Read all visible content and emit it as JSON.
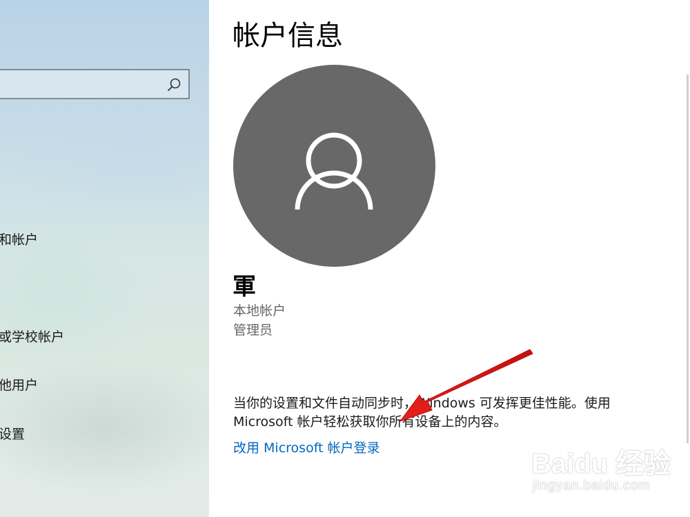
{
  "sidebar": {
    "search_placeholder": "",
    "items": [
      {
        "label": "和帐户"
      },
      {
        "label": "或学校帐户"
      },
      {
        "label": "他用户"
      },
      {
        "label": "设置"
      }
    ]
  },
  "main": {
    "title": "帐户信息",
    "user": {
      "name": "軍",
      "account_type": "本地帐户",
      "role": "管理员"
    },
    "description": "当你的设置和文件自动同步时，Windows 可发挥更佳性能。使用 Microsoft 帐户轻松获取你所有设备上的内容。",
    "link_label": "改用 Microsoft 帐户登录"
  },
  "colors": {
    "avatar_bg": "#686868",
    "link": "#0067c0",
    "arrow": "#e02020"
  },
  "watermark": {
    "main": "Baidu 经验",
    "sub": "jingyan.baidu.com"
  }
}
